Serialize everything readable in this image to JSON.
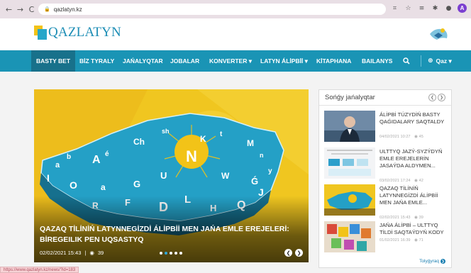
{
  "browser": {
    "url": "qazlatyn.kz",
    "back_icon": "←",
    "forward_icon": "→",
    "reload_icon": "C",
    "profile_initial": "A"
  },
  "header": {
    "logo_text": "QAZLATYN",
    "brand_colors": {
      "blue": "#1c8db5",
      "yellow": "#f2c318",
      "teal": "#27a7c9"
    }
  },
  "nav": {
    "items": [
      {
        "label": "BASTY BET",
        "active": true
      },
      {
        "label": "BİZ TYRALY"
      },
      {
        "label": "JAŃALYQTAR"
      },
      {
        "label": "JOBALAR"
      },
      {
        "label": "KONVERTER ▾"
      },
      {
        "label": "LATYN ÁLİPBİİ ▾"
      },
      {
        "label": "KİTAPHANA"
      },
      {
        "label": "BAILANYS"
      }
    ],
    "search_icon": "search-icon",
    "language": "Qaz ▾"
  },
  "slider": {
    "title": "QAZAQ TİLİNİŃ LATYNNEGİZDİ ÁLİPBİİ MEN JAŃA EMLE EREJELERİ: BİREGEILIK PEN UQSASTYQ",
    "date": "02/02/2021 15:43",
    "separator": "|",
    "views": "39",
    "dots": 5,
    "active_dot": 2
  },
  "news": {
    "heading": "Sońǵy jańalyqtar",
    "items": [
      {
        "title": "ÁLİPBİ TÚZYDİŃ BASTY QAǴIDALARY SAQTALDY",
        "date": "04/02/2021 10:27",
        "views": "45"
      },
      {
        "title": "ULTTYQ JAZÝ-SYZÝDYŃ EMLE EREJELERİN JASAÝDA ALDYMEN...",
        "date": "03/02/2021 17:24",
        "views": "42"
      },
      {
        "title": "QAZAQ TİLİNİŃ LATYNNEGİZDİ ÁLİPBİİ MEN JAŃA EMLE...",
        "date": "02/02/2021 15:43",
        "views": "39"
      },
      {
        "title": "JAŃA ÁLİPBİ – ULTTYQ TİLDİ SAQTAÝDYŃ KODY",
        "date": "01/02/2021 16:39",
        "views": "71"
      }
    ],
    "more_label": "Tolyǵyraq"
  },
  "status_bar": {
    "url": "https://www.qazlatyn.kz/news/?id=183"
  }
}
